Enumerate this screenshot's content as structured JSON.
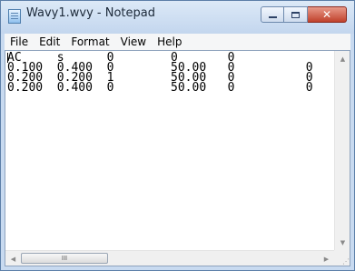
{
  "window": {
    "title": "Wavy1.wvy - Notepad",
    "icon": "notepad-icon",
    "caption_buttons": {
      "minimize": "minimize-icon",
      "maximize": "maximize-icon",
      "close": "✕"
    }
  },
  "menu": {
    "items": [
      "File",
      "Edit",
      "Format",
      "View",
      "Help"
    ]
  },
  "editor": {
    "lines": [
      "AC     s      0        0       0",
      "0.100  0.400  0        50.00   0          0",
      "0.200  0.200  1        50.00   0          0",
      "0.200  0.400  0        50.00   0          0"
    ]
  },
  "scrollbars": {
    "vertical_up": "▲",
    "vertical_down": "▼",
    "horizontal_left": "◀",
    "horizontal_right": "▶",
    "thumb_grip": "III",
    "size_grip": "⋰"
  }
}
